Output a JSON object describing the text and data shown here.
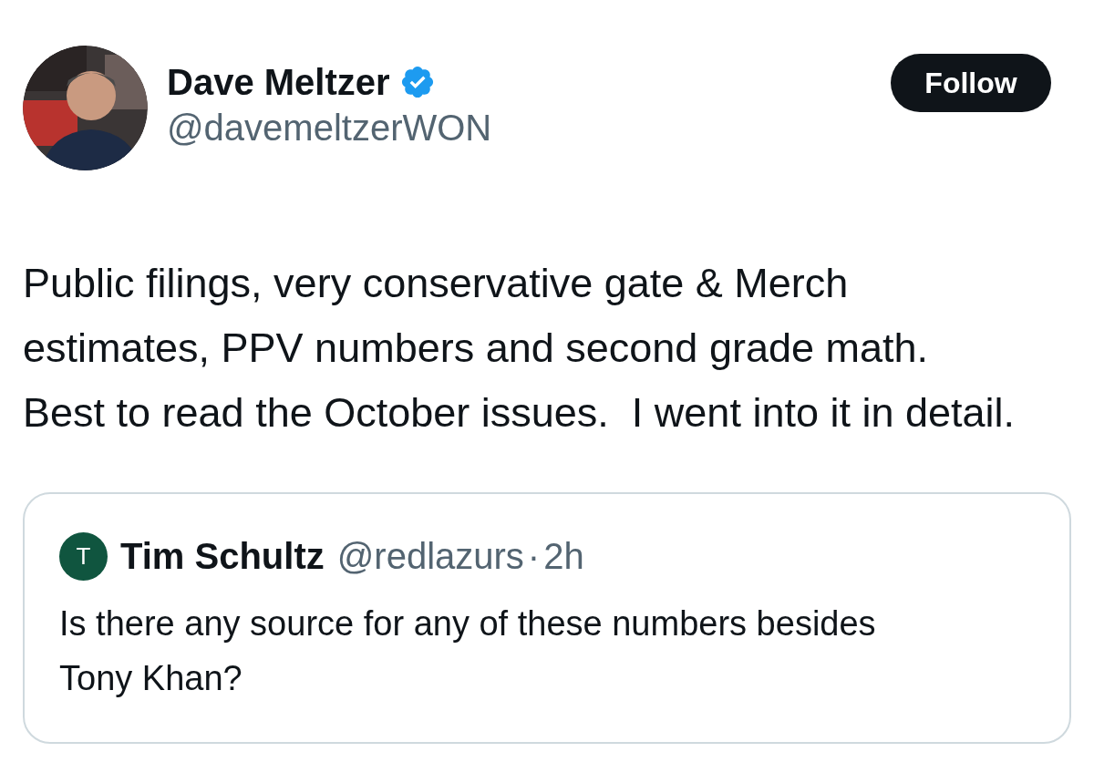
{
  "author": {
    "name": "Dave Meltzer",
    "verified": true,
    "handle": "@davemeltzerWON"
  },
  "follow_button": "Follow",
  "text": "Public filings, very conservative gate & Merch estimates, PPV numbers and second grade math.  Best to read the October issues.  I went into it in detail.",
  "quoted_tweet": {
    "avatar_letter": "T",
    "name": "Tim Schultz",
    "handle": "@redlazurs",
    "separator": "·",
    "time": "2h",
    "text": "Is there any source for any of these numbers besides Tony Khan?"
  }
}
